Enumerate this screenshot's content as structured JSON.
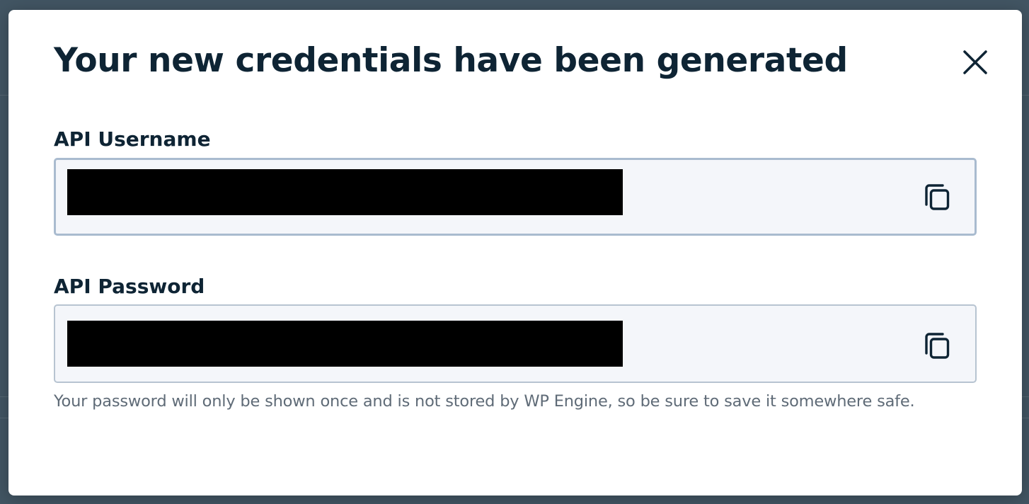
{
  "modal": {
    "title": "Your new credentials have been generated",
    "close_icon": "close-icon"
  },
  "fields": {
    "username": {
      "label": "API Username",
      "value_redacted": true,
      "copy_icon": "copy-icon"
    },
    "password": {
      "label": "API Password",
      "value_redacted": true,
      "copy_icon": "copy-icon"
    }
  },
  "help_text": "Your password will only be shown once and is not stored by WP Engine, so be sure to save it somewhere safe.",
  "colors": {
    "heading": "#0e2434",
    "muted_text": "#5f6b77",
    "field_background": "#f4f6fa",
    "field_border_focused": "#a9bbcf",
    "field_border": "#b7c4d1",
    "redaction": "#000000",
    "overlay": "#263a4a"
  }
}
